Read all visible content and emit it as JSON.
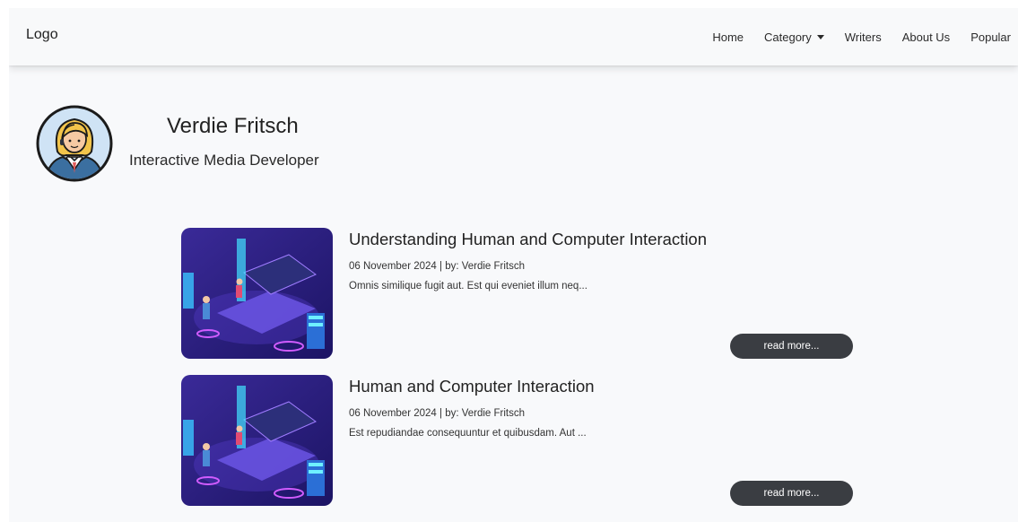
{
  "navbar": {
    "brand": "Logo",
    "links": [
      {
        "label": "Home"
      },
      {
        "label": "Category"
      },
      {
        "label": "Writers"
      },
      {
        "label": "About Us"
      },
      {
        "label": "Popular"
      }
    ]
  },
  "profile": {
    "name": "Verdie Fritsch",
    "role": "Interactive Media Developer",
    "avatar_icon": "woman-avatar-icon"
  },
  "articles": [
    {
      "title": "Understanding Human and Computer Interaction",
      "meta": "06 November 2024 | by: Verdie Fritsch",
      "excerpt": "Omnis similique fugit aut. Est qui eveniet illum neq...",
      "button": "read more..."
    },
    {
      "title": "Human and Computer Interaction",
      "meta": "06 November 2024 | by: Verdie Fritsch",
      "excerpt": "Est repudiandae consequuntur et quibusdam. Aut ...",
      "button": "read more..."
    }
  ],
  "colors": {
    "navbar_bg": "#f8f9fa",
    "page_bg": "#f8f9fb",
    "button_bg": "#3a3d42",
    "thumb_bg": "#2a1f7a"
  }
}
